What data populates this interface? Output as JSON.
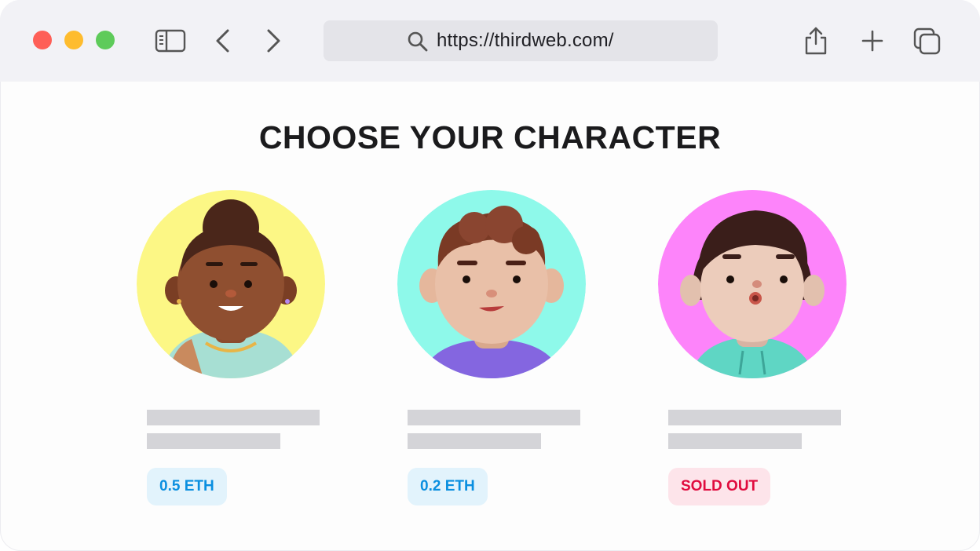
{
  "browser": {
    "url": "https://thirdweb.com/",
    "traffic_lights": [
      "close",
      "minimize",
      "zoom"
    ],
    "icons": [
      "sidebar-icon",
      "back-icon",
      "forward-icon",
      "search-icon",
      "share-icon",
      "new-tab-icon",
      "tabs-overview-icon"
    ]
  },
  "page": {
    "title": "CHOOSE YOUR CHARACTER"
  },
  "characters": [
    {
      "badge": "0.5 ETH",
      "status": "price",
      "bg_color": "#fcf785",
      "badge_bg": "#e2f3fc",
      "badge_color": "#0a8fe0"
    },
    {
      "badge": "0.2 ETH",
      "status": "price",
      "bg_color": "#8ef9ea",
      "badge_bg": "#e2f3fc",
      "badge_color": "#0a8fe0"
    },
    {
      "badge": "SOLD OUT",
      "status": "sold-out",
      "bg_color": "#fd84fa",
      "badge_bg": "#fde4ea",
      "badge_color": "#e00b3e"
    }
  ]
}
